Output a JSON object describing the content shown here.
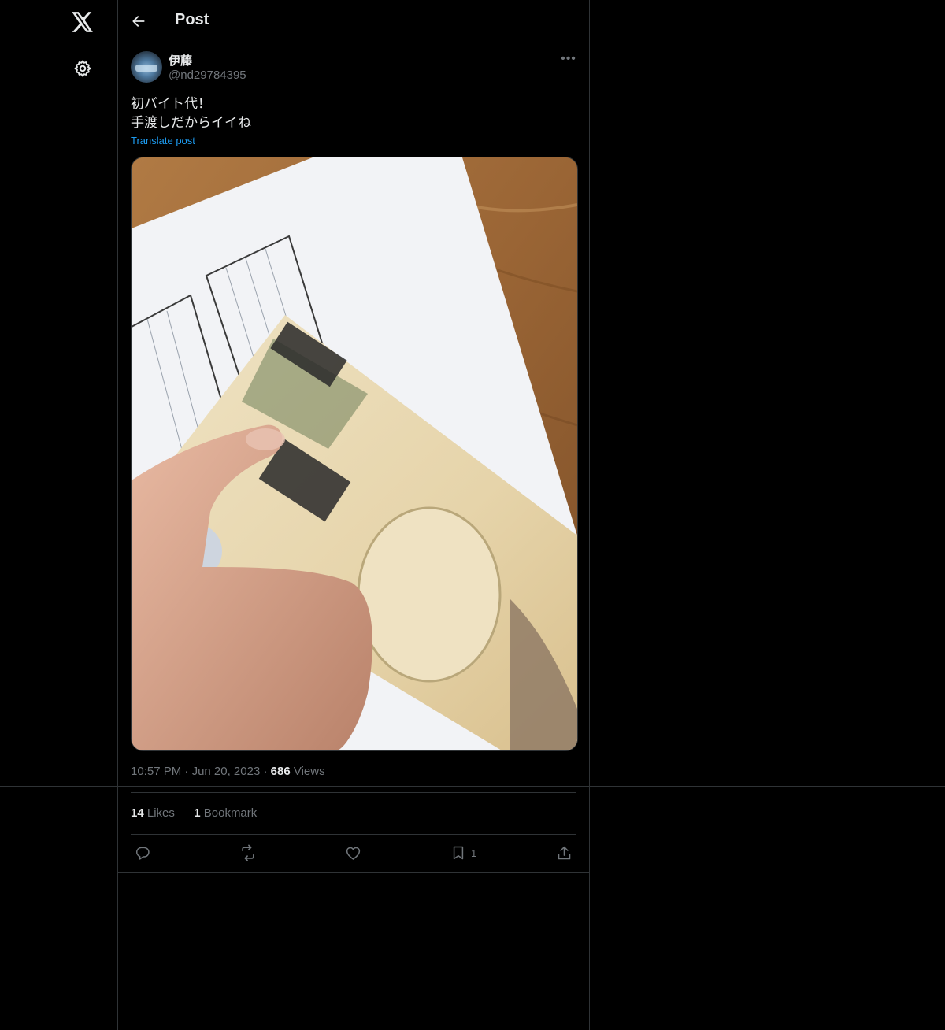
{
  "nav": {
    "logo_icon": "x-logo-icon",
    "settings_icon": "gear-icon"
  },
  "header": {
    "back_icon": "arrow-left-icon",
    "title": "Post"
  },
  "post": {
    "author": {
      "display_name": "伊藤",
      "handle": "@nd29784395"
    },
    "more_icon": "more-horizontal-icon",
    "text_lines": [
      "初バイト代！",
      "手渡しだからイイね"
    ],
    "translate_label": "Translate post",
    "media_description_icon": "photo",
    "time": "10:57 PM",
    "date": "Jun 20, 2023",
    "views_count": "686",
    "views_label": "Views",
    "likes_count": "14",
    "likes_label": "Likes",
    "bookmarks_count": "1",
    "bookmarks_label": "Bookmark",
    "actions": {
      "reply_icon": "reply-icon",
      "repost_icon": "repost-icon",
      "like_icon": "heart-icon",
      "bookmark_icon": "bookmark-icon",
      "bookmark_count": "1",
      "share_icon": "share-icon"
    }
  },
  "colors": {
    "background": "#000000",
    "text": "#e7e9ea",
    "muted": "#71767b",
    "link": "#1d9bf0",
    "border": "#2f3336"
  }
}
